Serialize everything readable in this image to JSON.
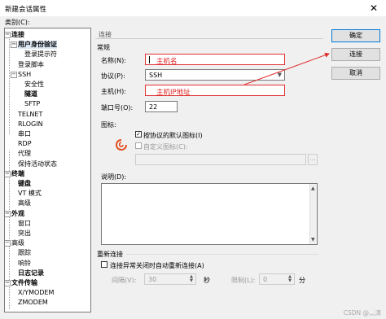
{
  "window": {
    "title": "新建会话属性",
    "close_glyph": "✕"
  },
  "category_label": "类别(C):",
  "tree": [
    {
      "label": "连接",
      "bold": true,
      "expander": "−"
    },
    {
      "label": "用户身份验证",
      "bold": true,
      "expander": "−",
      "selected": true
    },
    {
      "label": "登录提示符"
    },
    {
      "label": "登录脚本"
    },
    {
      "label": "SSH",
      "expander": "−"
    },
    {
      "label": "安全性"
    },
    {
      "label": "隧道",
      "bold": true
    },
    {
      "label": "SFTP"
    },
    {
      "label": "TELNET"
    },
    {
      "label": "RLOGIN"
    },
    {
      "label": "串口"
    },
    {
      "label": "RDP"
    },
    {
      "label": "代理"
    },
    {
      "label": "保持活动状态"
    },
    {
      "label": "终端",
      "bold": true,
      "expander": "−"
    },
    {
      "label": "键盘",
      "bold": true
    },
    {
      "label": "VT 模式"
    },
    {
      "label": "高级"
    },
    {
      "label": "外观",
      "bold": true,
      "expander": "−"
    },
    {
      "label": "窗口"
    },
    {
      "label": "突出"
    },
    {
      "label": "高级",
      "expander": "−"
    },
    {
      "label": "跟踪"
    },
    {
      "label": "响铃"
    },
    {
      "label": "日志记录",
      "bold": true
    },
    {
      "label": "文件传输",
      "bold": true,
      "expander": "−"
    },
    {
      "label": "X/YMODEM"
    },
    {
      "label": "ZMODEM"
    }
  ],
  "panel": {
    "breadcrumb": "连接",
    "general_label": "常规",
    "name_label": "名称(N):",
    "name_annotation": "主机名",
    "protocol_label": "协议(P):",
    "protocol_value": "SSH",
    "host_label": "主机(H):",
    "host_annotation": "主机IP地址",
    "port_label": "端口号(O):",
    "port_value": "22",
    "icon_label": "图标:",
    "default_icon_label": "按协议的默认图标(I)",
    "custom_icon_label": "自定义图标(C):",
    "browse_label": "...",
    "description_label": "说明(D):",
    "reconnect_label": "重新连接",
    "auto_reconnect_label": "连接异常关闭时自动重新连接(A)",
    "interval_label": "间隔(V):",
    "interval_value": "30",
    "seconds_label": "秒",
    "limit_label": "限制(L):",
    "limit_value": "0",
    "minutes_label": "分"
  },
  "buttons": {
    "ok": "确定",
    "connect": "连接",
    "cancel": "取消"
  },
  "watermark": "CSDN @灬涛",
  "colors": {
    "annotation_red": "#e02020",
    "arrow_red": "#e03030",
    "default_button_border": "#0078d7",
    "tree_selection": "#dde8f6"
  }
}
